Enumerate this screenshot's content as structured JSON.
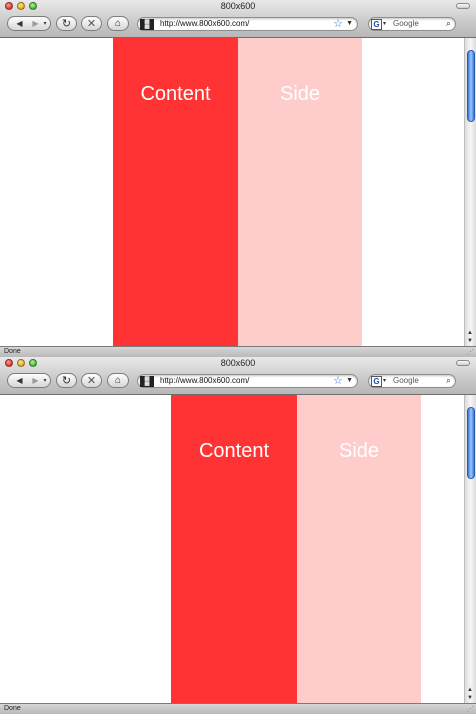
{
  "windows": [
    {
      "title": "800x600",
      "url": "http://www.800x600.com/",
      "search_placeholder": "Google",
      "status": "Done",
      "columns": [
        {
          "label": "Content",
          "color": "#ff3333"
        },
        {
          "label": "Side",
          "color": "#ffcccc"
        }
      ]
    },
    {
      "title": "800x600",
      "url": "http://www.800x600.com/",
      "search_placeholder": "Google",
      "status": "Done",
      "columns": [
        {
          "label": "Content",
          "color": "#ff3333"
        },
        {
          "label": "Side",
          "color": "#ffcccc"
        }
      ]
    }
  ],
  "icons": {
    "back": "back-arrow-icon",
    "forward": "forward-arrow-icon",
    "reload": "reload-icon",
    "stop": "stop-icon",
    "home": "home-icon",
    "bookmark": "star-icon",
    "search": "magnifier-icon",
    "engine": "google-icon"
  },
  "engine_glyph": "G"
}
